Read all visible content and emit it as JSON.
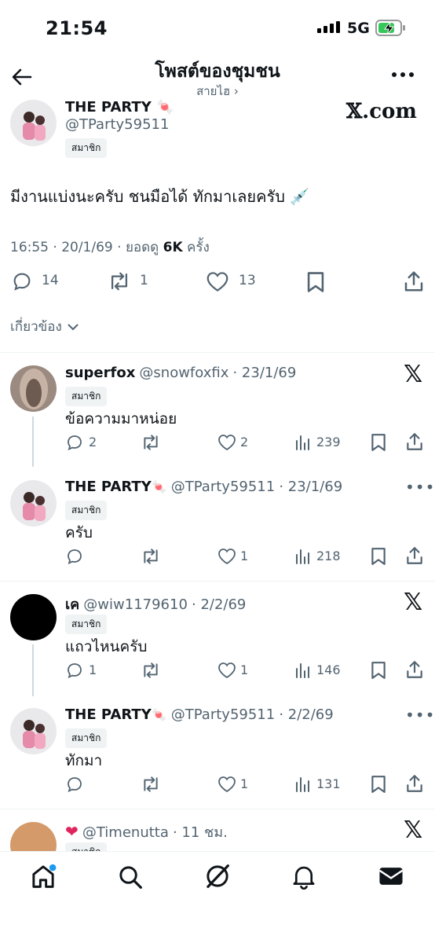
{
  "status_bar": {
    "time": "21:54",
    "network": "5G"
  },
  "header": {
    "title": "โพสต์ของชุมชน",
    "subtitle": "สายไฮ ›"
  },
  "post": {
    "name": "THE PARTY",
    "handle": "@TParty59511",
    "badge": "สมาชิก",
    "source": "𝕏.com",
    "text": "มีงานแบ่งนะครับ ชนมือได้ ทักมาเลยครับ",
    "datetime": "16:55 · 20/1/69 · ยอดดู",
    "views": "6K",
    "views_suffix": "ครั้ง",
    "replies": "14",
    "reposts": "1",
    "likes": "13",
    "sort_label": "เกี่ยวข้อง"
  },
  "replies": [
    {
      "name": "superfox",
      "handle": "@snowfoxfix",
      "date": "· 23/1/69",
      "badge": "สมาชิก",
      "text": "ข้อความมาหน่อย",
      "replies": "2",
      "reposts": "",
      "likes": "2",
      "views": "239"
    },
    {
      "name": "THE PARTY",
      "handle": "@TParty59511",
      "date": "· 23/1/69",
      "badge": "สมาชิก",
      "text": "ครับ",
      "replies": "",
      "reposts": "",
      "likes": "1",
      "views": "218"
    },
    {
      "name": "เค",
      "handle": "@wiw1179610",
      "date": "· 2/2/69",
      "badge": "สมาชิก",
      "text": "แถวไหนครับ",
      "replies": "1",
      "reposts": "",
      "likes": "1",
      "views": "146"
    },
    {
      "name": "THE PARTY",
      "handle": "@TParty59511",
      "date": "· 2/2/69",
      "badge": "สมาชิก",
      "text": "ทักมา",
      "replies": "",
      "reposts": "",
      "likes": "1",
      "views": "131"
    },
    {
      "name": "",
      "handle": "@Timenutta",
      "date": "· 11 ชม.",
      "badge": "สมาชิก",
      "text": "",
      "replies": "",
      "reposts": "",
      "likes": "",
      "views": ""
    }
  ],
  "nav": [
    "home-icon",
    "search-icon",
    "grok-icon",
    "notifications-icon",
    "messages-icon"
  ]
}
